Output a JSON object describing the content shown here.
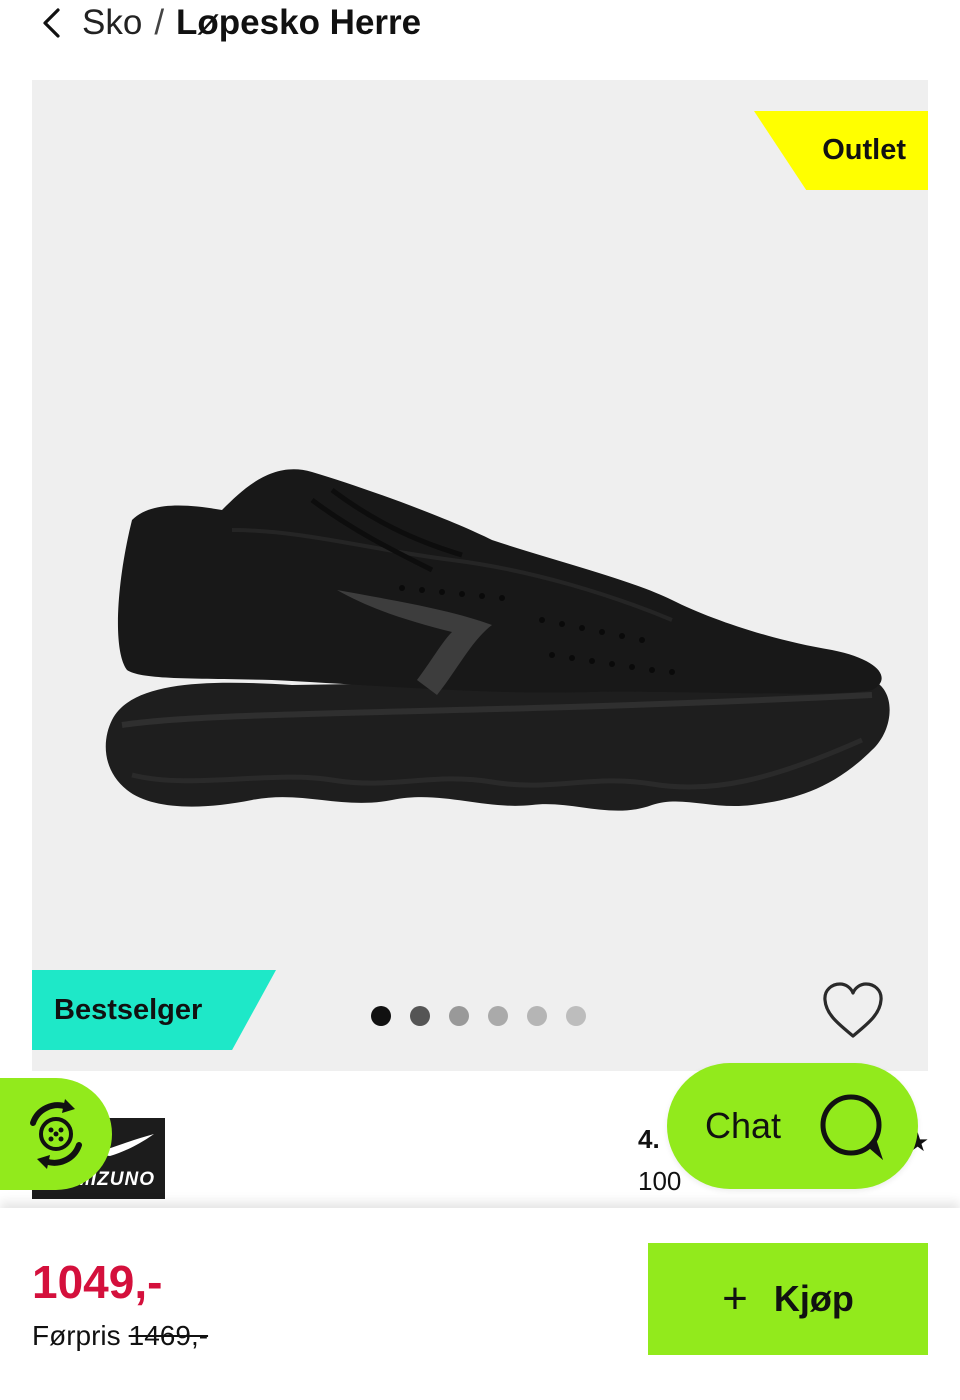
{
  "breadcrumb": {
    "parent": "Sko",
    "separator": "/",
    "current": "Løpesko Herre"
  },
  "product": {
    "badges": {
      "outlet": "Outlet",
      "bestseller": "Bestselger"
    },
    "gallery": {
      "image_count": 6,
      "active_index": 0
    },
    "brand_logo_text": "MIZUNO",
    "rating_text": "4.",
    "recommend_text": "100",
    "rating_icon": "★"
  },
  "chat": {
    "label": "Chat",
    "icon": "chat-bubble-icon"
  },
  "purchase": {
    "price": "1049,-",
    "former_label": "Førpris",
    "former_price": "1469,-",
    "buy_label": "Kjøp",
    "buy_icon": "+"
  },
  "colors": {
    "accent_green": "#92ea1c",
    "price_red": "#d4103c",
    "outlet_yellow": "#ffff00",
    "bestseller_teal": "#1ee8c8"
  }
}
